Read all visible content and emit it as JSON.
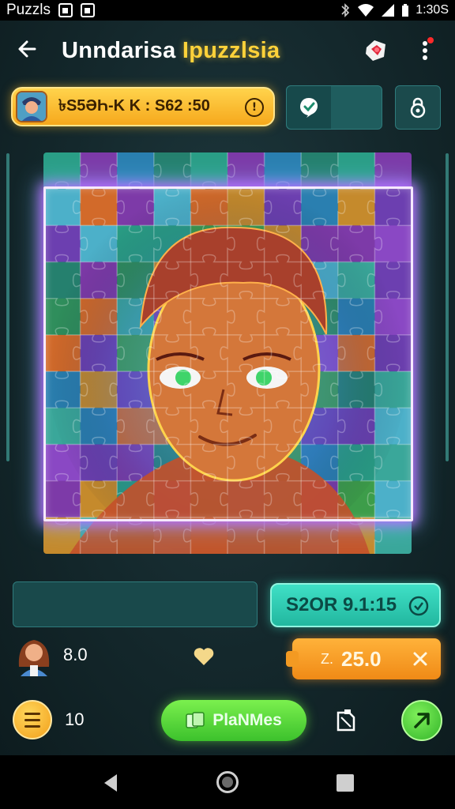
{
  "status_bar": {
    "app_name": "Puzzls",
    "time": "1:30S"
  },
  "header": {
    "title_part1": "Unndarisa",
    "title_part2": "Ipuzzlsia",
    "back_icon": "arrow-left-icon",
    "gem_icon": "gem-icon",
    "more_icon": "more-vert-icon"
  },
  "timer": {
    "text": "৳S5ӘҺ-K K : S62 :50",
    "info_label": "!"
  },
  "toolbar": {
    "hint_icon": "hint-bubble-icon",
    "lock_icon": "lock-icon"
  },
  "board": {
    "cols": 10,
    "rows": 11,
    "palette": [
      "#2a9e86",
      "#3aa79a",
      "#6c3fb0",
      "#7d3aa8",
      "#2f8e5c",
      "#3d9d4a",
      "#2a7fb0",
      "#4cb0c9",
      "#8a48c4",
      "#25806e",
      "#c58a2c",
      "#d26a2a"
    ],
    "portrait_skin": "#d4773a",
    "portrait_hair": "#a8402c",
    "portrait_eye": "#3fd46a",
    "glow": "#b86cff"
  },
  "footer": {
    "score_button_label": "S2OR 9.1:15",
    "player_score": "8.0",
    "reward_prefix": "Z.",
    "reward_value": "25.0",
    "menu_count": "10",
    "play_label": "PlaNMes"
  },
  "colors": {
    "accent_gold": "#f6a81c",
    "accent_teal": "#22b79f",
    "accent_green": "#3cc12c",
    "accent_orange": "#f08a16",
    "background": "#14282c"
  }
}
